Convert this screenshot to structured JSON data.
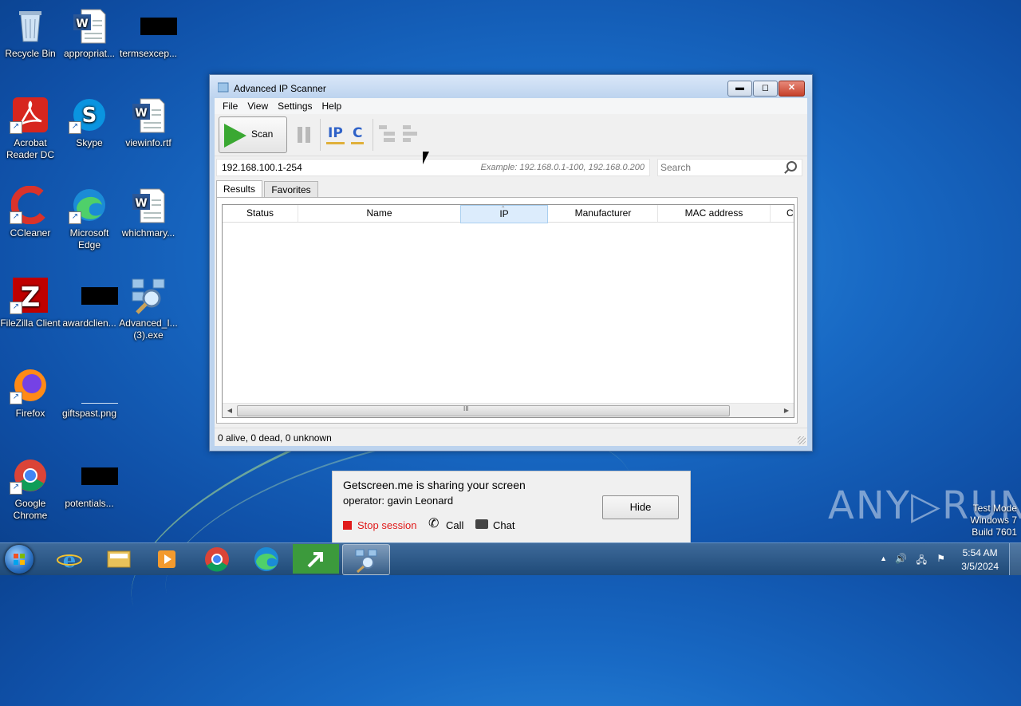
{
  "desktop": {
    "icons": [
      {
        "label": "Recycle Bin"
      },
      {
        "label": "appropriat..."
      },
      {
        "label": "termsexcep..."
      },
      {
        "label": "Acrobat Reader DC"
      },
      {
        "label": "Skype"
      },
      {
        "label": "viewinfo.rtf"
      },
      {
        "label": "CCleaner"
      },
      {
        "label": "Microsoft Edge"
      },
      {
        "label": "whichmary..."
      },
      {
        "label": "FileZilla Client"
      },
      {
        "label": "awardclien..."
      },
      {
        "label": "Advanced_I... (3).exe"
      },
      {
        "label": "Firefox"
      },
      {
        "label": "giftspast.png"
      },
      {
        "label": "Google Chrome"
      },
      {
        "label": "potentials..."
      }
    ]
  },
  "window": {
    "title": "Advanced IP Scanner",
    "minimize_glyph": "▬",
    "maximize_glyph": "◻",
    "close_glyph": "✕",
    "menu": [
      "File",
      "View",
      "Settings",
      "Help"
    ],
    "toolbar": {
      "scan_label": "Scan",
      "ip_label": "IP",
      "c_label": "C"
    },
    "address": {
      "value": "192.168.100.1-254",
      "example": "Example: 192.168.0.1-100, 192.168.0.200"
    },
    "search": {
      "placeholder": "Search"
    },
    "tabs": [
      "Results",
      "Favorites"
    ],
    "columns": [
      "Status",
      "Name",
      "IP",
      "Manufacturer",
      "MAC address",
      "C"
    ],
    "sort_arrow": "^",
    "scroll_left": "◀",
    "scroll_right": "▶",
    "scroll_grip": "III",
    "status_text": "0 alive, 0 dead, 0 unknown"
  },
  "share_popup": {
    "line1": "Getscreen.me is sharing your screen",
    "line2": "operator: gavin Leonard",
    "hide_label": "Hide",
    "stop_label": "Stop session",
    "call_label": "Call",
    "chat_label": "Chat",
    "call_icon": "✆"
  },
  "watermark": {
    "brand": "ANY▷RUN",
    "line1": "Test Mode",
    "line2": "Windows 7",
    "line3": "Build 7601"
  },
  "taskbar": {
    "time": "5:54 AM",
    "date": "3/5/2024",
    "tray_arrow": "▲",
    "volume_icon": "🔊",
    "flag_icon": "⚑",
    "network_icon": "🖧"
  }
}
